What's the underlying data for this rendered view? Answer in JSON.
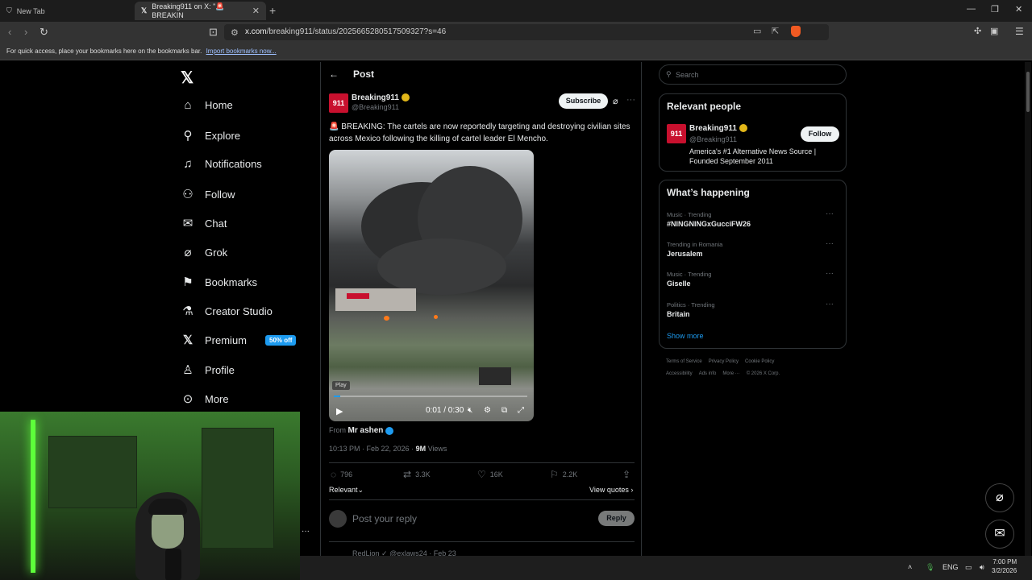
{
  "browser": {
    "tabs": [
      {
        "title": "New Tab"
      },
      {
        "title": "Breaking911 on X: \"🚨 BREAKIN",
        "active": true
      }
    ],
    "url_host": "x.com",
    "url_path": "/breaking911/status/2025665280517509327?s=46",
    "bookmarks_hint": "For quick access, place your bookmarks here on the bookmarks bar.",
    "bookmarks_link": "Import bookmarks now..."
  },
  "nav": {
    "items": [
      {
        "label": "Home",
        "icon": "home-icon"
      },
      {
        "label": "Explore",
        "icon": "search-icon"
      },
      {
        "label": "Notifications",
        "icon": "bell-icon"
      },
      {
        "label": "Follow",
        "icon": "person-add-icon"
      },
      {
        "label": "Chat",
        "icon": "mail-icon"
      },
      {
        "label": "Grok",
        "icon": "grok-icon"
      },
      {
        "label": "Bookmarks",
        "icon": "bookmark-icon"
      },
      {
        "label": "Creator Studio",
        "icon": "flask-icon"
      },
      {
        "label": "Premium",
        "icon": "x-icon"
      },
      {
        "label": "Profile",
        "icon": "person-icon"
      },
      {
        "label": "More",
        "icon": "more-circle-icon"
      }
    ],
    "premium_badge": "50% off"
  },
  "post": {
    "header_title": "Post",
    "author_name": "Breaking911",
    "author_handle": "@Breaking911",
    "subscribe_label": "Subscribe",
    "text": "🚨 BREAKING: The cartels are now reportedly targeting and destroying civilian sites across Mexico following the killing of cartel leader El Mencho.",
    "video": {
      "play_tag": "Play",
      "time": "0:01 / 0:30",
      "progress": 0.033
    },
    "from_label": "From",
    "from_name": "Mr ashen",
    "timestamp": "10:13 PM · Feb 22, 2026 · ",
    "views_count": "9M",
    "views_label": " Views",
    "stats": {
      "replies": "796",
      "reposts": "3.3K",
      "likes": "16K",
      "bookmarks": "2.2K"
    },
    "sort_label": "Relevant",
    "view_quotes": "View quotes",
    "reply_placeholder": "Post your reply",
    "reply_button": "Reply",
    "next_post_preview": "RedLion  ✓  @exlaws24 · Feb 23"
  },
  "sidebar": {
    "search_placeholder": "Search",
    "relevant_people": {
      "title": "Relevant people",
      "name": "Breaking911",
      "handle": "@Breaking911",
      "follow_label": "Follow",
      "bio": "America's #1 Alternative News Source | Founded September 2011"
    },
    "happening": {
      "title": "What’s happening",
      "trends": [
        {
          "context": "Music · Trending",
          "name": "#NINGNINGxGucciFW26"
        },
        {
          "context": "Trending in Romania",
          "name": "Jerusalem"
        },
        {
          "context": "Music · Trending",
          "name": "Giselle"
        },
        {
          "context": "Politics · Trending",
          "name": "Britain"
        }
      ],
      "show_more": "Show more"
    },
    "footer_row1": [
      "Terms of Service",
      "Privacy Policy",
      "Cookie Policy"
    ],
    "footer_row2": [
      "Accessibility",
      "Ads info",
      "More ···",
      "© 2026 X Corp."
    ]
  },
  "taskbar": {
    "lang": "ENG",
    "time": "7:00 PM",
    "date": "3/2/2026"
  },
  "colors": {
    "accent": "#1d9bf0",
    "verified_gold": "#e2b719",
    "brand_red": "#c8102e"
  }
}
